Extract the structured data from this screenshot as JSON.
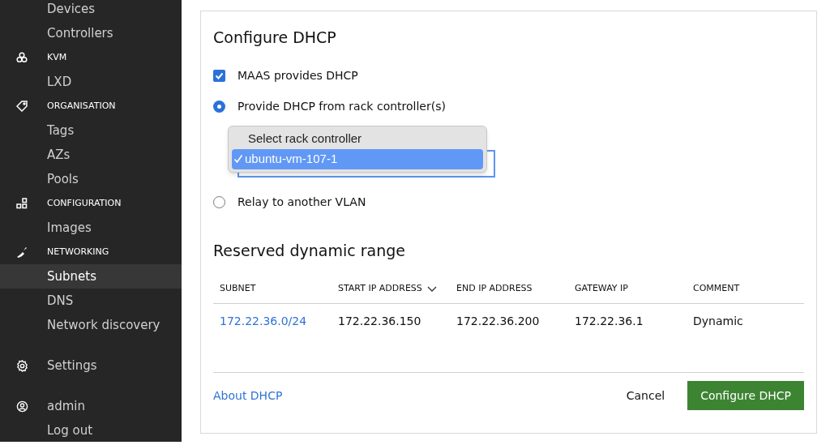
{
  "sidebar": {
    "groups": [
      {
        "items": [
          {
            "kind": "link",
            "label": "Devices",
            "selected": false
          },
          {
            "kind": "link",
            "label": "Controllers",
            "selected": false
          },
          {
            "kind": "heading",
            "label": "KVM"
          },
          {
            "kind": "link",
            "label": "LXD",
            "selected": false
          },
          {
            "kind": "heading",
            "label": "ORGANISATION"
          },
          {
            "kind": "link",
            "label": "Tags",
            "selected": false
          },
          {
            "kind": "link",
            "label": "AZs",
            "selected": false
          },
          {
            "kind": "link",
            "label": "Pools",
            "selected": false
          },
          {
            "kind": "heading",
            "label": "CONFIGURATION"
          },
          {
            "kind": "link",
            "label": "Images",
            "selected": false
          },
          {
            "kind": "heading",
            "label": "NETWORKING"
          },
          {
            "kind": "link",
            "label": "Subnets",
            "selected": true
          },
          {
            "kind": "link",
            "label": "DNS",
            "selected": false
          },
          {
            "kind": "link",
            "label": "Network discovery",
            "selected": false
          }
        ]
      },
      {
        "items": [
          {
            "kind": "iconlink",
            "label": "Settings",
            "selected": false
          }
        ]
      },
      {
        "items": [
          {
            "kind": "iconlink",
            "label": "admin",
            "selected": false
          },
          {
            "kind": "link",
            "label": "Log out",
            "selected": false
          }
        ]
      }
    ]
  },
  "form": {
    "title": "Configure DHCP",
    "options": [
      {
        "kind": "checkbox",
        "label": "MAAS provides DHCP",
        "checked": true
      },
      {
        "kind": "radio",
        "label": "Provide DHCP from rack controller(s)",
        "selected": true
      },
      {
        "kind": "select",
        "options": [
          {
            "label": "Select rack controller",
            "selected": false
          },
          {
            "label": "ubuntu-vm-107-1",
            "selected": true
          }
        ]
      },
      {
        "kind": "radio",
        "label": "Relay to another VLAN",
        "selected": false
      }
    ],
    "section_title": "Reserved dynamic range",
    "table": {
      "columns": [
        {
          "label": "SUBNET",
          "sorted": false
        },
        {
          "label": "START IP ADDRESS",
          "sorted": true
        },
        {
          "label": "END IP ADDRESS",
          "sorted": false
        },
        {
          "label": "GATEWAY IP",
          "sorted": false
        },
        {
          "label": "COMMENT",
          "sorted": false
        }
      ],
      "rows": [
        [
          "172.22.36.0/24",
          "172.22.36.150",
          "172.22.36.200",
          "172.22.36.1",
          "Dynamic"
        ]
      ]
    },
    "help_link": "About DHCP",
    "cancel": "Cancel",
    "submit": "Configure DHCP"
  }
}
